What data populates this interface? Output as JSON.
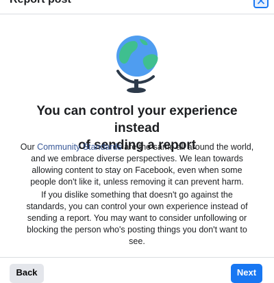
{
  "dialog": {
    "title": "Report post",
    "close_icon": "close-icon"
  },
  "illustration": {
    "icon": "globe-icon"
  },
  "content": {
    "headline_line1": "You can control your experience instead",
    "headline_line2": "of sending a report",
    "p1_prefix": "Our ",
    "p1_link": "Community Standards",
    "p1_line1_rest": " are the same all around the world,",
    "p1_line2": "and we embrace diverse perspectives. We lean towards",
    "p1_line3": "allowing content to stay on Facebook, even when some",
    "p1_line4": "people don't like it, unless removing it can prevent harm.",
    "p2_line1": "If you dislike something that doesn't go against the",
    "p2_line2": "standards, you can control your own experience instead of",
    "p2_line3": "sending a report. You may want to consider unfollowing or",
    "p2_line4": "blocking the person who's posting things you don't want to",
    "p2_line5": "see."
  },
  "footer": {
    "back_label": "Back",
    "next_label": "Next"
  },
  "colors": {
    "accent": "#1877f2",
    "link": "#385898",
    "globe_ocean": "#4f9df0",
    "globe_land": "#3fbf8f",
    "stand": "#2d3a4a"
  }
}
